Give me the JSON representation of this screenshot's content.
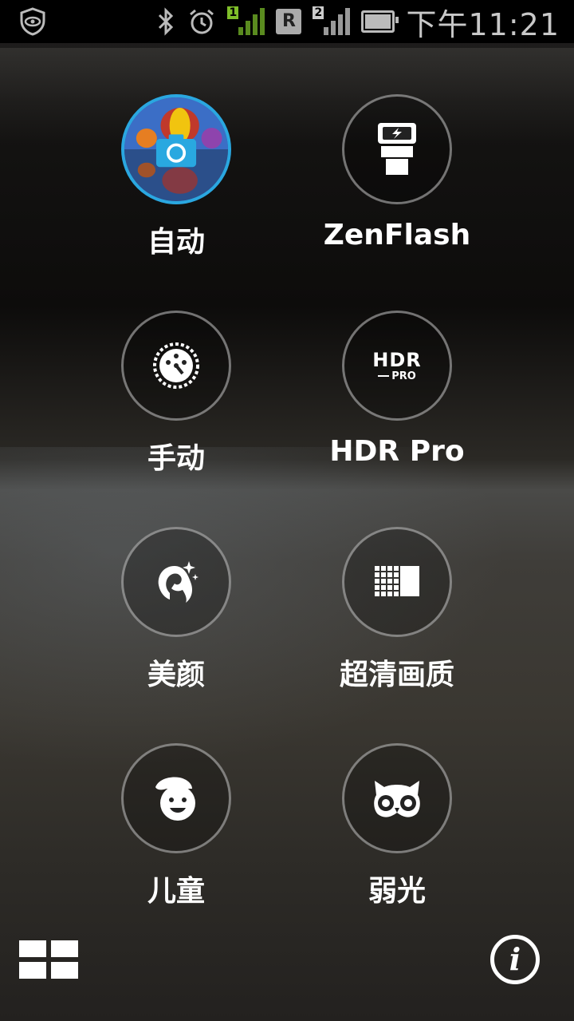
{
  "status_bar": {
    "time": "下午11:21",
    "sim1_label": "1",
    "sim2_label": "2",
    "roaming_label": "R",
    "icons": [
      "shield-eye-icon",
      "bluetooth-icon",
      "alarm-icon",
      "signal-icon",
      "battery-icon"
    ]
  },
  "modes": [
    {
      "label": "自动",
      "icon": "auto-camera-icon",
      "selected": true
    },
    {
      "label": "ZenFlash",
      "icon": "flash-icon",
      "selected": false
    },
    {
      "label": "手动",
      "icon": "manual-dial-icon",
      "selected": false
    },
    {
      "label": "HDR Pro",
      "icon": "hdr-pro-icon",
      "icon_text_main": "HDR",
      "icon_text_sub": "PRO",
      "selected": false
    },
    {
      "label": "美颜",
      "icon": "beautification-icon",
      "selected": false
    },
    {
      "label": "超清画质",
      "icon": "super-resolution-icon",
      "selected": false
    },
    {
      "label": "儿童",
      "icon": "children-icon",
      "selected": false
    },
    {
      "label": "弱光",
      "icon": "low-light-owl-icon",
      "selected": false
    }
  ],
  "bottom": {
    "left_icon": "grid-icon",
    "right_icon": "info-icon",
    "info_glyph": "i"
  },
  "colors": {
    "accent": "#2aa7e0",
    "signal_green": "#7fbf2a"
  }
}
